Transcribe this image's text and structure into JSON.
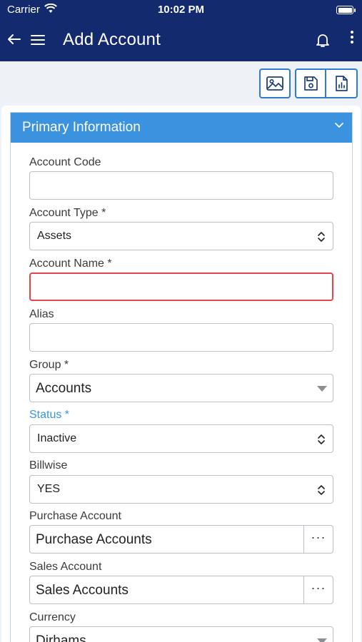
{
  "status_bar": {
    "carrier": "Carrier",
    "time": "10:02 PM"
  },
  "app_bar": {
    "title": "Add Account"
  },
  "panel": {
    "title": "Primary Information"
  },
  "fields": {
    "account_code": {
      "label": "Account Code",
      "value": ""
    },
    "account_type": {
      "label": "Account Type *",
      "value": "Assets"
    },
    "account_name": {
      "label": "Account Name *",
      "value": ""
    },
    "alias": {
      "label": "Alias",
      "value": ""
    },
    "group": {
      "label": "Group *",
      "value": "Accounts"
    },
    "status": {
      "label": "Status *",
      "value": "Inactive"
    },
    "billwise": {
      "label": "Billwise",
      "value": "YES"
    },
    "purchase_account": {
      "label": "Purchase Account",
      "value": "Purchase Accounts",
      "lookup": "···"
    },
    "sales_account": {
      "label": "Sales Account",
      "value": "Sales Accounts",
      "lookup": "···"
    },
    "currency": {
      "label": "Currency",
      "value": "Dirhams"
    }
  },
  "colors": {
    "navbar": "#142a6e",
    "panel_header": "#3b93e0",
    "accent": "#2e7bd1",
    "error": "#e0464b"
  },
  "icons": [
    "back-arrow-icon",
    "hamburger-menu-icon",
    "bell-icon",
    "more-vertical-icon",
    "image-icon",
    "save-icon",
    "report-icon",
    "chevron-down-icon",
    "up-down-icon",
    "caret-down-icon"
  ]
}
